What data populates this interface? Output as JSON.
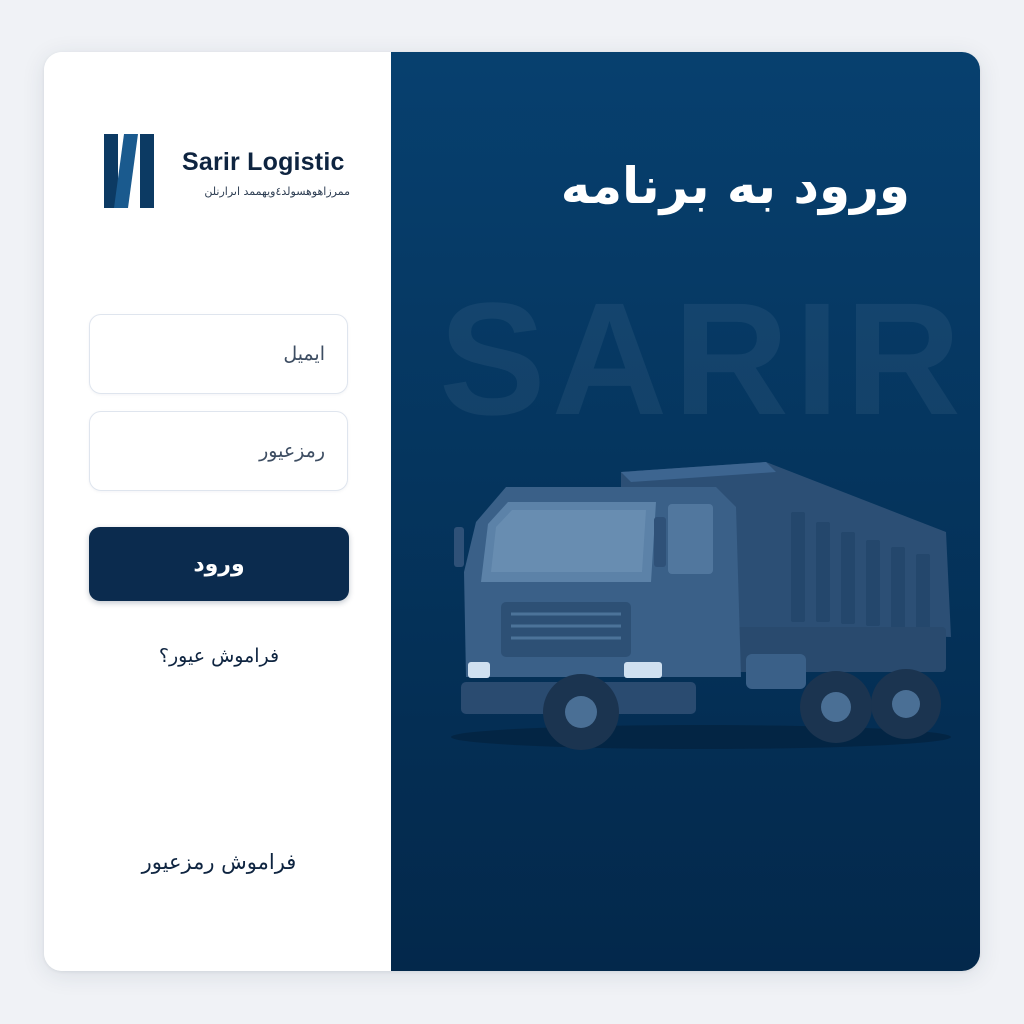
{
  "brand": {
    "name": "Sarir Logistic",
    "tagline": "ممرزاهوهسولد٤ويهممد اىرارنلن"
  },
  "login_form": {
    "email_placeholder": "ایمیل",
    "password_placeholder": "رمزعیور",
    "submit_label": "ورود",
    "forgot_link": "فراموش عیور؟"
  },
  "footer": {
    "forgot_password_link": "فراموش رمزعیور"
  },
  "hero": {
    "title": "ورود به برنامه",
    "watermark": "SARIR",
    "illustration": "dump-truck-icon"
  },
  "colors": {
    "primary": "#0b2b4e",
    "panel_top": "#07406f",
    "panel_bottom": "#03284b",
    "page_bg": "#f0f2f6"
  }
}
